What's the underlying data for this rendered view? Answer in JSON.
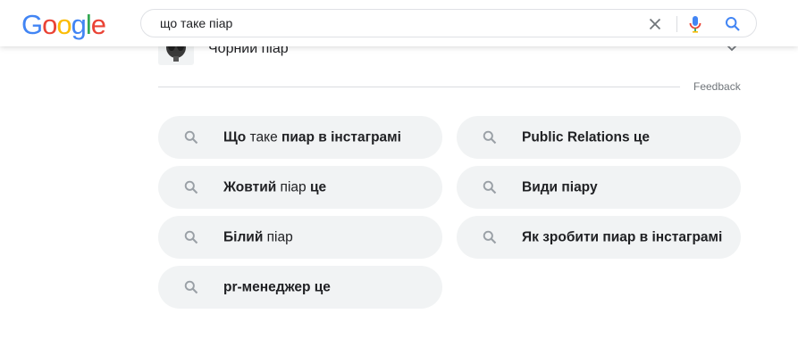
{
  "header": {
    "logo": {
      "letters": [
        {
          "ch": "G",
          "color": "#4285F4"
        },
        {
          "ch": "o",
          "color": "#EA4335"
        },
        {
          "ch": "o",
          "color": "#FBBC05"
        },
        {
          "ch": "g",
          "color": "#4285F4"
        },
        {
          "ch": "l",
          "color": "#34A853"
        },
        {
          "ch": "e",
          "color": "#EA4335"
        }
      ]
    },
    "search": {
      "value": "що таке піар",
      "placeholder": ""
    },
    "icons": {
      "clear": "close-icon",
      "mic": "mic-icon",
      "search": "search-icon"
    },
    "colors": {
      "mic_blue": "#4285F4",
      "mic_red": "#EA4335",
      "search_blue": "#4285F4",
      "clear_gray": "#70757a"
    }
  },
  "previous_item": {
    "label": "Чорний піар"
  },
  "feedback": "Feedback",
  "related_searches": [
    {
      "parts": [
        {
          "t": "Що",
          "b": true
        },
        {
          "t": " таке ",
          "b": false
        },
        {
          "t": "пиар в інстаграмі",
          "b": true
        }
      ]
    },
    {
      "parts": [
        {
          "t": "Public Relations це",
          "b": true
        }
      ]
    },
    {
      "parts": [
        {
          "t": "Жовтий",
          "b": true
        },
        {
          "t": " піар ",
          "b": false
        },
        {
          "t": "це",
          "b": true
        }
      ]
    },
    {
      "parts": [
        {
          "t": "Види піару",
          "b": true
        }
      ]
    },
    {
      "parts": [
        {
          "t": "Білий",
          "b": true
        },
        {
          "t": " піар",
          "b": false
        }
      ]
    },
    {
      "parts": [
        {
          "t": "Як зробити пиар в інстаграмі",
          "b": true
        }
      ]
    },
    {
      "parts": [
        {
          "t": "pr-менеджер це",
          "b": true
        }
      ]
    }
  ],
  "colors": {
    "chip_bg": "#f1f3f4",
    "text": "#202124",
    "muted": "#70757a",
    "icon_gray": "#9aa0a6"
  }
}
